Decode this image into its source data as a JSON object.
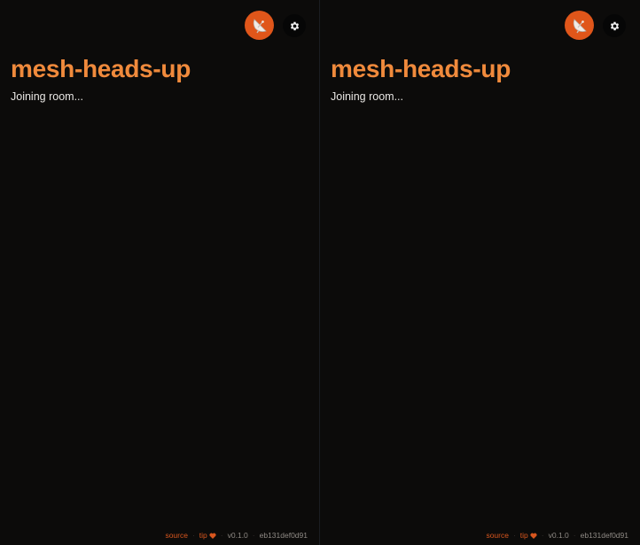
{
  "panes": [
    {
      "title": "mesh-heads-up",
      "status": "Joining room...",
      "footer": {
        "source_label": "source",
        "tip_label": "tip",
        "version": "v0.1.0",
        "commit": "eb131def0d91"
      }
    },
    {
      "title": "mesh-heads-up",
      "status": "Joining room...",
      "footer": {
        "source_label": "source",
        "tip_label": "tip",
        "version": "v0.1.0",
        "commit": "eb131def0d91"
      }
    }
  ],
  "icons": {
    "avatar": "satellite-dish-icon",
    "settings": "gear-icon",
    "tip": "heart-icon"
  },
  "colors": {
    "background": "#0c0b0a",
    "accent": "#f08a3c",
    "avatar_bg": "#e0561a",
    "link": "#d8561e",
    "text": "#e8e6e3",
    "muted": "#8f8a85"
  }
}
